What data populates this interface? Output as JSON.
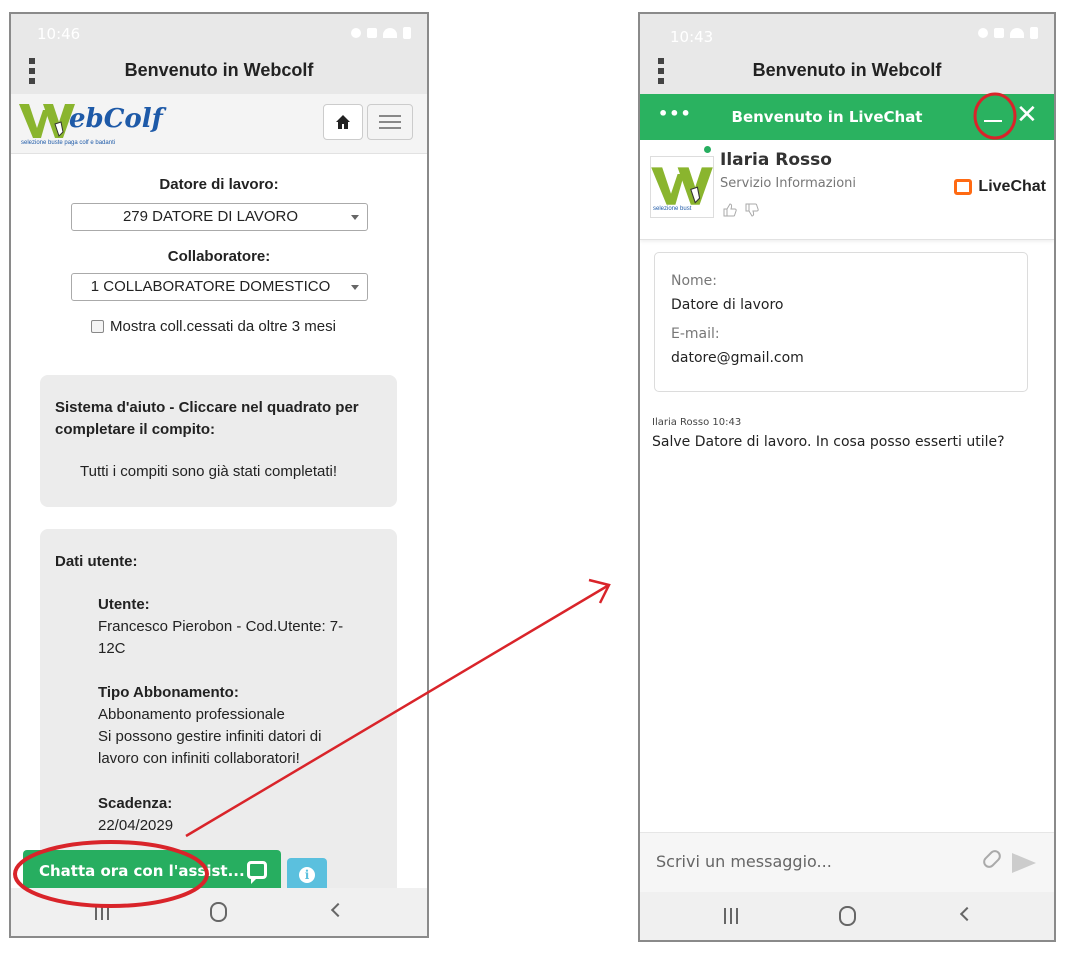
{
  "left_phone": {
    "status_time": "10:46",
    "app_title": "Benvenuto in Webcolf",
    "logo_text": "ebColf",
    "logo_subtitle": "selezione  buste paga  colf e badanti",
    "datore_label": "Datore di lavoro:",
    "datore_value": "279 DATORE DI LAVORO",
    "collaboratore_label": "Collaboratore:",
    "collaboratore_value": "1 COLLABORATORE DOMESTICO",
    "checkbox_label": "Mostra coll.cessati da oltre 3 mesi",
    "help_card": {
      "title_line1": "Sistema d'aiuto - Cliccare nel quadrato per",
      "title_line2": "completare il compito:",
      "message": "Tutti i compiti sono già stati completati!"
    },
    "user_card": {
      "title": "Dati utente:",
      "utente_label": "Utente:",
      "utente_line1": "Francesco Pierobon - Cod.Utente: 7-",
      "utente_line2": "12C",
      "abbonamento_label": "Tipo Abbonamento:",
      "abbonamento_line1": "Abbonamento professionale",
      "abbonamento_line2": "Si possono gestire infiniti datori di",
      "abbonamento_line3": "lavoro con infiniti collaboratori!",
      "scadenza_label": "Scadenza:",
      "scadenza_value": "22/04/2029"
    },
    "chat_button_label": "Chatta ora con l'assist...",
    "info_icon": "i"
  },
  "right_phone": {
    "status_time": "10:43",
    "app_title": "Benvenuto in Webcolf",
    "livechat_header": "Benvenuto in LiveChat",
    "header_dots": "•••",
    "close_glyph": "✕",
    "agent_name": "Ilaria Rosso",
    "agent_role": "Servizio Informazioni",
    "agent_logo_sub": "selezione  bust",
    "brand": "LiveChat",
    "form": {
      "name_label": "Nome:",
      "name_value": "Datore di lavoro",
      "email_label": "E-mail:",
      "email_value": "datore@gmail.com"
    },
    "message_meta": "Ilaria Rosso 10:43",
    "message_text": "Salve Datore di lavoro. In cosa posso esserti utile?",
    "composer_placeholder": "Scrivi un messaggio..."
  },
  "icons": [
    "kebab-menu-icon",
    "home-icon",
    "hamburger-icon",
    "chat-bubble-icon",
    "info-icon",
    "minimize-icon",
    "close-icon",
    "thumbs-up-icon",
    "thumbs-down-icon",
    "livechat-logo-icon",
    "attach-icon",
    "send-icon",
    "nav-recent-icon",
    "nav-home-icon",
    "nav-back-icon"
  ],
  "colors": {
    "livechat_green": "#2ab260",
    "chat_button_green": "#27ae60",
    "info_blue": "#5bc0de",
    "annotation_red": "#d9242a",
    "livechat_orange": "#ff6a13",
    "logo_blue": "#1e5aa8",
    "logo_green": "#8ab52e"
  }
}
